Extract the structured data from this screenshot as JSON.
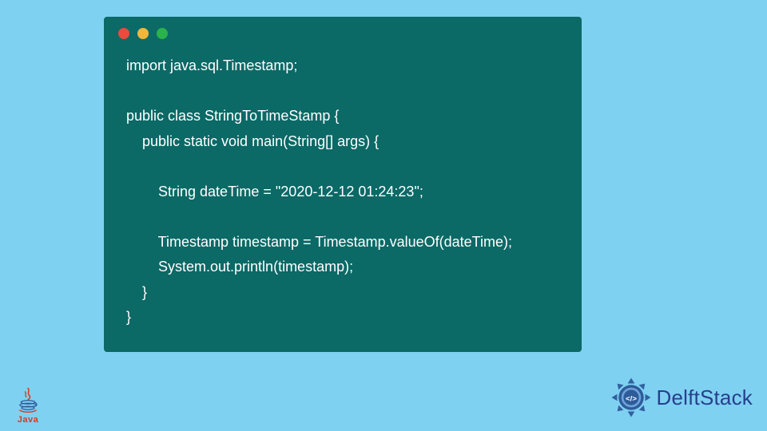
{
  "code": {
    "lines": [
      "import java.sql.Timestamp;",
      "",
      "public class StringToTimeStamp {",
      "    public static void main(String[] args) {",
      "",
      "        String dateTime = \"2020-12-12 01:24:23\";",
      "",
      "        Timestamp timestamp = Timestamp.valueOf(dateTime);",
      "        System.out.println(timestamp);",
      "    }",
      "}"
    ]
  },
  "branding": {
    "java_label": "Java",
    "delft_label": "DelftStack"
  },
  "colors": {
    "page_bg": "#7fd1f2",
    "code_bg": "#0b6966",
    "code_fg": "#ffffff",
    "java_accent": "#d13f1d",
    "delft_accent": "#26408b"
  },
  "window": {
    "dots": [
      "red",
      "yellow",
      "green"
    ]
  }
}
